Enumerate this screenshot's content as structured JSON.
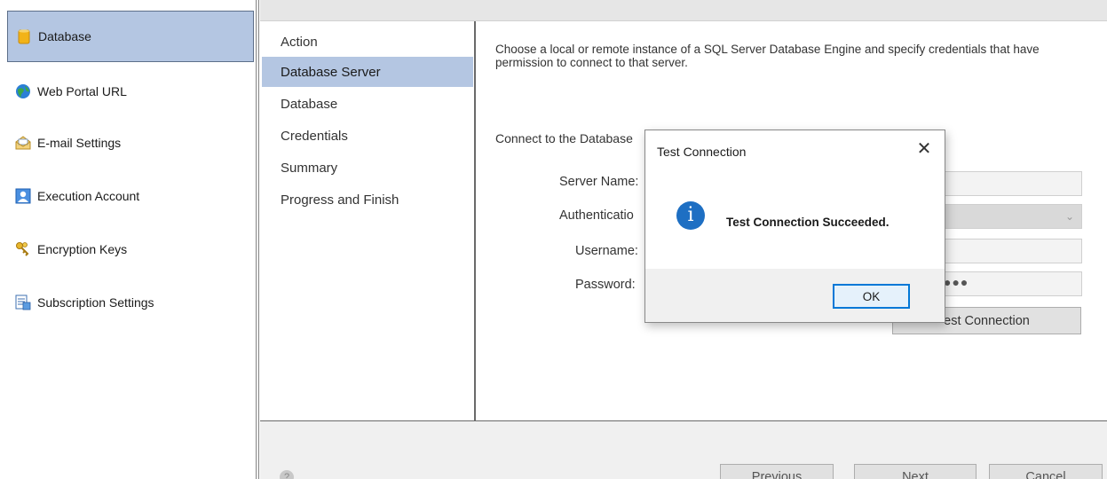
{
  "sidebar": {
    "items": [
      {
        "label": "Database",
        "icon": "database-icon",
        "selected": true
      },
      {
        "label": "Web Portal URL",
        "icon": "globe-icon"
      },
      {
        "label": "E-mail Settings",
        "icon": "email-icon"
      },
      {
        "label": "Execution Account",
        "icon": "user-account-icon"
      },
      {
        "label": "Encryption Keys",
        "icon": "keys-icon"
      },
      {
        "label": "Subscription Settings",
        "icon": "subscription-icon"
      }
    ]
  },
  "wizard": {
    "steps": [
      "Action",
      "Database Server",
      "Database",
      "Credentials",
      "Summary",
      "Progress and Finish"
    ],
    "active_step": "Database Server",
    "description": "Choose a local or remote instance of a SQL Server Database Engine and specify credentials that have permission to connect to that server.",
    "connect_label": "Connect to the Database",
    "fields": {
      "server_name_label": "Server Name:",
      "authentication_label": "Authenticatio",
      "username_label": "Username:",
      "password_label": "Password:",
      "password_value": "●●●"
    },
    "test_connection_label": "est Connection"
  },
  "footer": {
    "previous_label": "Previous",
    "next_label": "Next",
    "cancel_label": "Cancel"
  },
  "dialog": {
    "title": "Test Connection",
    "close_glyph": "✕",
    "message": "Test Connection Succeeded.",
    "ok_label": "OK",
    "info_glyph": "i"
  },
  "colors": {
    "selection": "#b4c6e2",
    "dialog_accent": "#0078d7",
    "info_icon": "#1e6fc3"
  }
}
